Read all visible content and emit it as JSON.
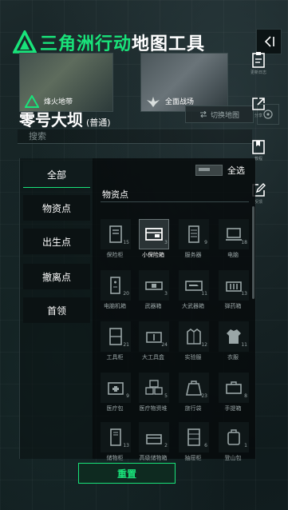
{
  "header": {
    "title_green": "三角洲行动",
    "title_white": "地图工具"
  },
  "maps": [
    {
      "label": "烽火地带",
      "icon": "delta-flag-icon"
    },
    {
      "label": "全面战场",
      "icon": "wing-emblem-icon"
    }
  ],
  "current_map": {
    "name": "零号大坝",
    "mode": "(普通)"
  },
  "switch_map_label": "切换地图",
  "search": {
    "placeholder": "搜索"
  },
  "tools": [
    {
      "label": "更新日志",
      "icon": "clipboard-icon"
    },
    {
      "label": "分享",
      "icon": "share-icon"
    },
    {
      "label": "教程",
      "icon": "book-icon"
    },
    {
      "label": "反馈",
      "icon": "edit-icon"
    }
  ],
  "categories": [
    {
      "label": "全部",
      "active": true
    },
    {
      "label": "物资点",
      "active": false
    },
    {
      "label": "出生点",
      "active": false
    },
    {
      "label": "撤离点",
      "active": false
    },
    {
      "label": "首领",
      "active": false
    }
  ],
  "select_all_label": "全选",
  "section_title": "物资点",
  "items": [
    {
      "name": "保险柜",
      "count": "15",
      "icon": "safe-icon"
    },
    {
      "name": "小保险箱",
      "count": "3",
      "icon": "small-safe-icon",
      "selected": true
    },
    {
      "name": "服务器",
      "count": "9",
      "icon": "server-icon"
    },
    {
      "name": "电脑",
      "count": "18",
      "icon": "computer-icon"
    },
    {
      "name": "电脑机箱",
      "count": "20",
      "icon": "pc-case-icon"
    },
    {
      "name": "武器箱",
      "count": "3",
      "icon": "weapon-case-icon"
    },
    {
      "name": "大武器箱",
      "count": "11",
      "icon": "large-weapon-case-icon"
    },
    {
      "name": "弹药箱",
      "count": "13",
      "icon": "ammo-box-icon"
    },
    {
      "name": "工具柜",
      "count": "21",
      "icon": "tool-cabinet-icon"
    },
    {
      "name": "大工具盒",
      "count": "24",
      "icon": "large-toolbox-icon"
    },
    {
      "name": "实验服",
      "count": "12",
      "icon": "lab-coat-icon"
    },
    {
      "name": "衣服",
      "count": "11",
      "icon": "clothes-icon"
    },
    {
      "name": "医疗包",
      "count": "9",
      "icon": "medkit-icon"
    },
    {
      "name": "医疗物资堆",
      "count": "5",
      "icon": "medical-supplies-icon"
    },
    {
      "name": "旅行袋",
      "count": "23",
      "icon": "travel-bag-icon"
    },
    {
      "name": "手提箱",
      "count": "8",
      "icon": "suitcase-icon"
    },
    {
      "name": "储物柜",
      "count": "13",
      "icon": "locker-icon"
    },
    {
      "name": "高级储物箱",
      "count": "2",
      "icon": "premium-storage-icon"
    },
    {
      "name": "抽屉柜",
      "count": "6",
      "icon": "drawer-cabinet-icon"
    },
    {
      "name": "登山包",
      "count": "1",
      "icon": "backpack-icon"
    }
  ],
  "reset_label": "重置",
  "colors": {
    "accent": "#19e37a",
    "panel": "#0b1213",
    "text": "#e6eceb"
  }
}
